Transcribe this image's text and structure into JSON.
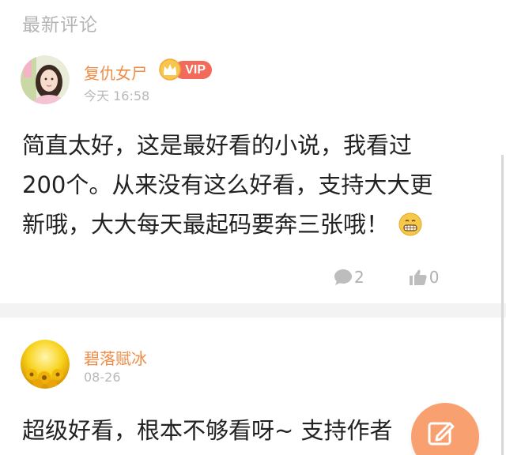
{
  "section": {
    "title": "最新评论"
  },
  "comments": [
    {
      "username": "复仇女尸",
      "vip_label": "VIP",
      "time": "今天 16:58",
      "text_line1": "简直太好，这是最好看的小说，我看过",
      "text_line2": "200个。从来没有这么好看，支持大大更",
      "text_line3": "新哦，大大每天最起码要奔三张哦！",
      "emoji": "grin-emoji",
      "reply_count": "2",
      "like_count": "0"
    },
    {
      "username": "碧落赋冰",
      "time": "08-26",
      "text_line1": "超级好看，根本不够看呀~ 支持作者"
    }
  ],
  "colors": {
    "username": "#f08c46",
    "fab": "#f8a070",
    "vip": "#f16a5a"
  },
  "icons": {
    "reply": "comment-bubble-icon",
    "like": "thumbs-up-icon",
    "fab": "edit-icon"
  }
}
